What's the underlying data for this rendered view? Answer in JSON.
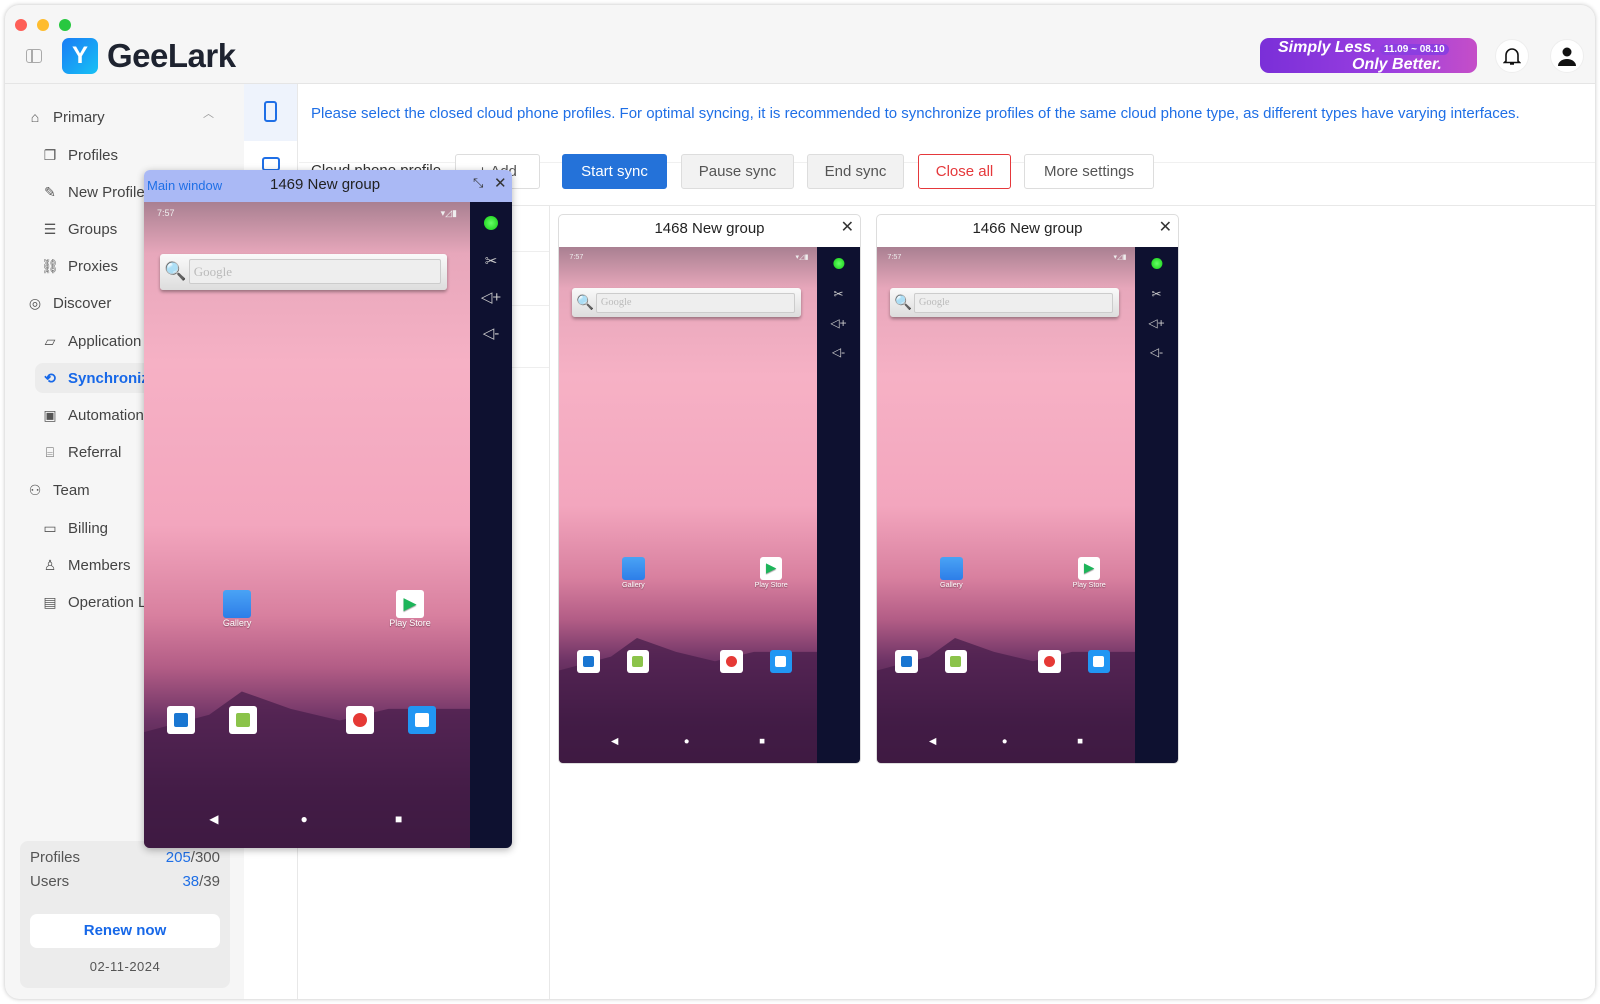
{
  "header": {
    "brand": "GeeLark",
    "logo_glyph": "Y",
    "promo": {
      "line1": "Simply Less.",
      "dates": "11.09 ~ 08.10",
      "line2": "Only Better."
    }
  },
  "sidebar": {
    "items": [
      {
        "label": "Primary",
        "icon": "home-icon",
        "level": "h"
      },
      {
        "label": "Profiles",
        "icon": "profiles-icon",
        "level": "s"
      },
      {
        "label": "New Profile",
        "icon": "edit-icon",
        "level": "s"
      },
      {
        "label": "Groups",
        "icon": "list-icon",
        "level": "s"
      },
      {
        "label": "Proxies",
        "icon": "proxy-icon",
        "level": "s"
      },
      {
        "label": "Discover",
        "icon": "planet-icon",
        "level": "h"
      },
      {
        "label": "Application",
        "icon": "app-icon",
        "level": "s"
      },
      {
        "label": "Synchronizer",
        "icon": "sync-icon",
        "level": "s",
        "active": true
      },
      {
        "label": "Automation",
        "icon": "robot-icon",
        "level": "s"
      },
      {
        "label": "Referral",
        "icon": "gift-icon",
        "level": "s"
      },
      {
        "label": "Team",
        "icon": "team-icon",
        "level": "h"
      },
      {
        "label": "Billing",
        "icon": "wallet-icon",
        "level": "s"
      },
      {
        "label": "Members",
        "icon": "member-icon",
        "level": "s"
      },
      {
        "label": "Operation Log",
        "icon": "log-icon",
        "level": "s"
      }
    ],
    "usage": {
      "profiles_label": "Profiles",
      "profiles_used": "205",
      "profiles_total": "/300",
      "users_label": "Users",
      "users_used": "38",
      "users_total": "/39",
      "renew": "Renew now",
      "date": "02-11-2024"
    }
  },
  "main": {
    "notice": "Please select the closed cloud phone profiles. For optimal syncing, it is recommended to synchronize profiles of the same cloud phone type, as different types have varying interfaces.",
    "profile_label": "Cloud phone profile",
    "add": "+ Add",
    "start": "Start sync",
    "pause": "Pause sync",
    "end": "End sync",
    "close_all": "Close all",
    "more": "More settings"
  },
  "floating": {
    "main_window": "Main window",
    "title": "1469 New group"
  },
  "phones": [
    {
      "title": "1469 New group"
    },
    {
      "title": "1468 New group"
    },
    {
      "title": "1466 New group"
    }
  ],
  "phone_screen": {
    "time": "7:57",
    "search_placeholder": "Google",
    "apps": [
      "Gallery",
      "Play Store"
    ]
  },
  "colors": {
    "accent": "#1f6fe6",
    "danger": "#e5383b",
    "main_window_bar": "#aab9f5"
  }
}
